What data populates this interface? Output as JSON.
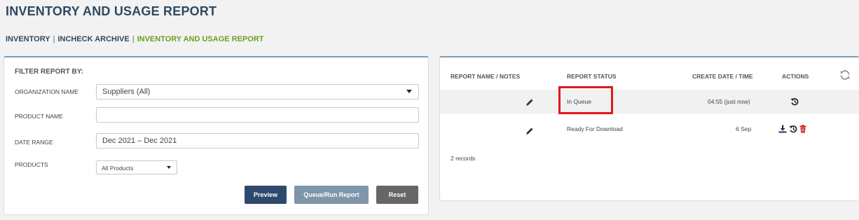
{
  "page": {
    "title": "INVENTORY AND USAGE REPORT"
  },
  "breadcrumb": {
    "items": [
      "INVENTORY",
      "INCHECK ARCHIVE",
      "INVENTORY AND USAGE REPORT"
    ],
    "separator": "|"
  },
  "filters": {
    "heading": "FILTER REPORT BY:",
    "organization": {
      "label": "ORGANIZATION NAME",
      "value": "Suppliers (All)"
    },
    "product_name": {
      "label": "PRODUCT NAME",
      "value": ""
    },
    "date_range": {
      "label": "DATE RANGE",
      "value": "Dec 2021 – Dec 2021"
    },
    "products": {
      "label": "PRODUCTS",
      "value": "All Products"
    },
    "buttons": {
      "preview": "Preview",
      "queue": "Queue/Run Report",
      "reset": "Reset"
    }
  },
  "reports": {
    "columns": {
      "name": "REPORT NAME / NOTES",
      "status": "REPORT STATUS",
      "date": "CREATE DATE / TIME",
      "actions": "ACTIONS"
    },
    "rows": [
      {
        "status": "In Queue",
        "date": "04:55 (just now)",
        "actions": [
          "history-icon"
        ]
      },
      {
        "status": "Ready For Download",
        "date": "6 Sep",
        "actions": [
          "download-icon",
          "history-icon",
          "trash-icon"
        ]
      }
    ],
    "records_label": "2 records"
  },
  "colors": {
    "title": "#2d4a63",
    "breadcrumb_active": "#6aa121",
    "highlight": "#e0191f",
    "btn_preview": "#2d4a6e",
    "btn_queue": "#7e95aa",
    "btn_reset": "#666666",
    "trash": "#c0161b"
  }
}
